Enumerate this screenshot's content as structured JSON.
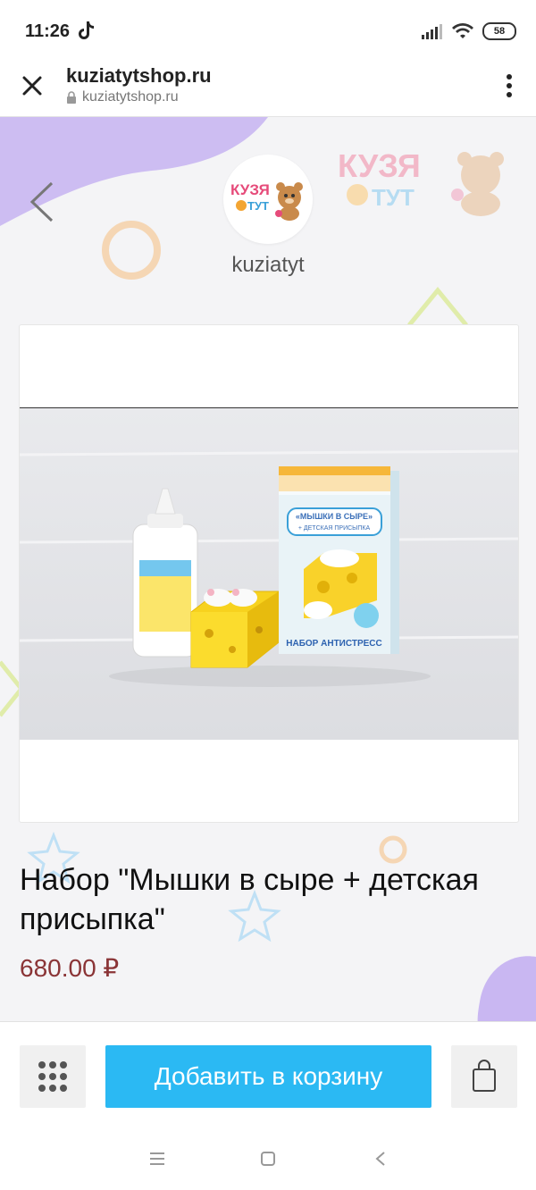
{
  "status_bar": {
    "time": "11:26",
    "battery": "58"
  },
  "browser": {
    "title": "kuziatytshop.ru",
    "url": "kuziatytshop.ru"
  },
  "store": {
    "name": "kuziatyt",
    "logo_text_top": "КУЗЯ",
    "logo_text_bottom": "ТУТ"
  },
  "product": {
    "title": "Набор \"Мышки в сыре + детская присыпка\"",
    "price": "680.00 ₽",
    "box_title": "«МЫШКИ В СЫРЕ»",
    "box_subtitle": "+ ДЕТСКАЯ ПРИСЫПКА",
    "box_footer": "НАБОР АНТИСТРЕСС"
  },
  "actions": {
    "add_to_cart": "Добавить в корзину"
  },
  "colors": {
    "accent": "#2bb9f3",
    "price": "#8a3436"
  }
}
